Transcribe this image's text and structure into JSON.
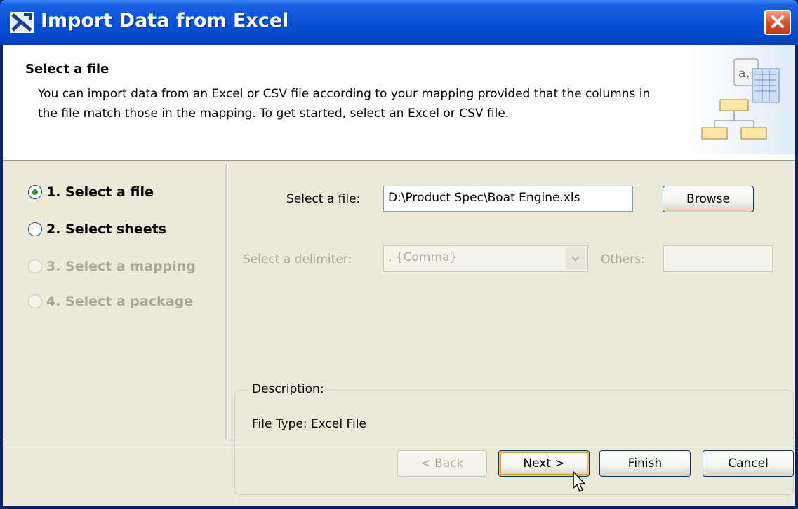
{
  "window": {
    "title": "Import Data from Excel"
  },
  "header": {
    "title": "Select a file",
    "description": "You can import data from an Excel or CSV file according to your mapping provided that the columns in the file match those in the mapping. To get started, select an Excel or CSV file."
  },
  "steps": [
    {
      "label": "1. Select a file",
      "state": "selected"
    },
    {
      "label": "2. Select sheets",
      "state": "enabled"
    },
    {
      "label": "3. Select a mapping",
      "state": "disabled"
    },
    {
      "label": "4. Select a package",
      "state": "disabled"
    }
  ],
  "form": {
    "file_label": "Select a file:",
    "file_value": "D:\\Product Spec\\Boat Engine.xls",
    "browse_label": "Browse",
    "delimiter_label": "Select a delimiter:",
    "delimiter_value": ", {Comma}",
    "others_label": "Others:",
    "others_value": ""
  },
  "description": {
    "legend": "Description:",
    "text": "File Type: Excel File"
  },
  "footer": {
    "back_label": "< Back",
    "next_label": "Next >",
    "finish_label": "Finish",
    "cancel_label": "Cancel"
  },
  "colors": {
    "title_bar": "#0a52d8",
    "client_bg": "#ece9d8",
    "selected_radio": "#21a121",
    "disabled_text": "#aca899"
  }
}
